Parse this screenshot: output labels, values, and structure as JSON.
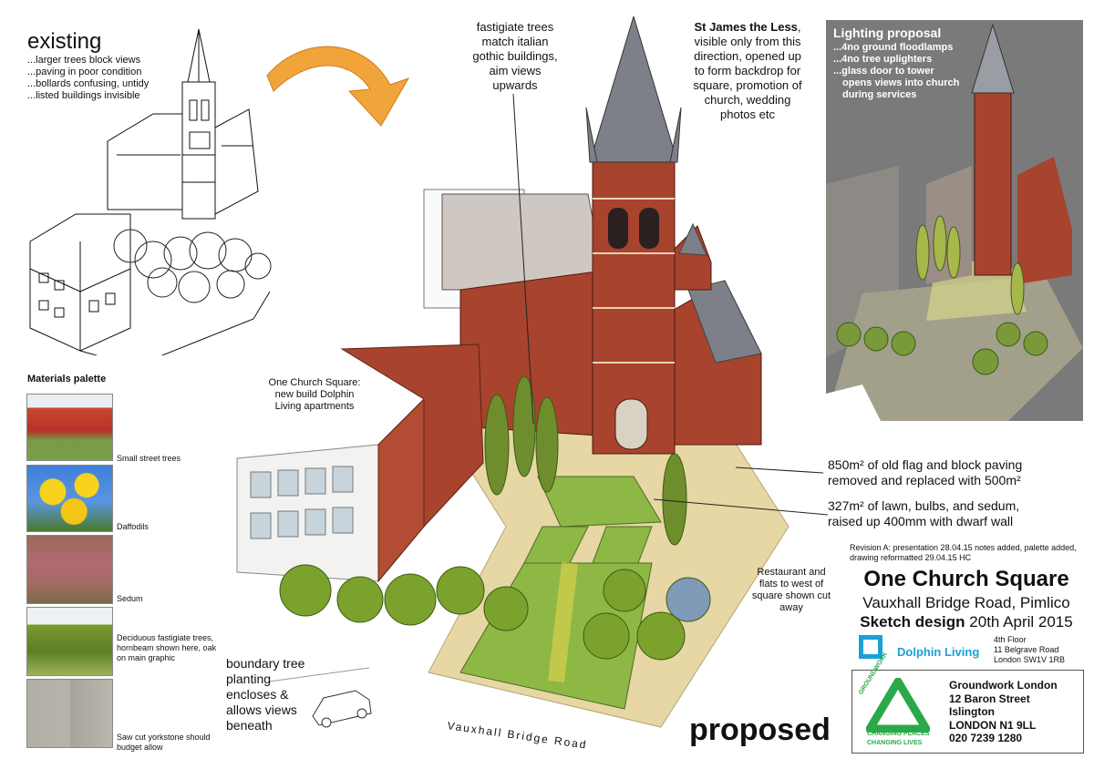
{
  "existing": {
    "heading": "existing",
    "notes": [
      "...larger trees block views",
      "...paving in poor condition",
      "...bollards confusing, untidy",
      "...listed buildings invisible"
    ]
  },
  "annotations": {
    "fastigiate": [
      "fastigiate trees",
      "match italian",
      "gothic buildings,",
      "aim views",
      "upwards"
    ],
    "church_bold": "St James the Less",
    "church_rest": [
      "visible only from this",
      "direction, opened up",
      "to form backdrop for",
      "square, promotion of",
      "church, wedding",
      "photos etc"
    ],
    "one_church": [
      "One Church Square:",
      "new build Dolphin",
      "Living apartments"
    ],
    "paving": [
      "850m² of old flag and block paving",
      "removed and replaced with 500m²"
    ],
    "lawn": [
      "327m² of lawn, bulbs, and sedum,",
      "raised up 400mm with dwarf wall"
    ],
    "restaurant": [
      "Restaurant and",
      "flats to west of",
      "square shown cut",
      "away"
    ],
    "boundary": [
      "boundary tree",
      "planting",
      "encloses &",
      "allows views",
      "beneath"
    ],
    "road": "Vauxhall Bridge Road",
    "proposed": "proposed"
  },
  "lighting": {
    "title": "Lighting proposal",
    "items": [
      "...4no ground floodlamps",
      "...4no tree uplighters",
      "...glass door to tower",
      "opens views into church",
      "during services"
    ]
  },
  "palette": {
    "title": "Materials palette",
    "items": [
      {
        "label": "Small street trees",
        "icon": "street-trees-photo"
      },
      {
        "label": "Daffodils",
        "icon": "daffodils-photo"
      },
      {
        "label": "Sedum",
        "icon": "sedum-photo"
      },
      {
        "label": "Deciduous fastigiate trees, hornbeam shown here, oak on main graphic",
        "icon": "fastigiate-trees-photo"
      },
      {
        "label": "Saw cut yorkstone should budget allow",
        "icon": "yorkstone-photo"
      }
    ]
  },
  "revision": [
    "Revision A: presentation 28.04.15 notes added, palette added,",
    "drawing reformatted 29.04.15 HC"
  ],
  "title_block": {
    "title": "One Church Square",
    "subtitle": "Vauxhall Bridge Road, Pimlico",
    "design_bold": "Sketch design",
    "design_date": "20th April 2015"
  },
  "dolphin": {
    "name": "Dolphin Living",
    "address": [
      "4th Floor",
      "11 Belgrave Road",
      "London SW1V 1RB"
    ],
    "color": "#1aa0d8"
  },
  "groundwork": {
    "logo_text": "GROUNDWORK",
    "tag1": "CHANGING PLACES",
    "tag2": "CHANGING LIVES",
    "address": [
      "Groundwork London",
      "12 Baron Street",
      "Islington",
      "LONDON N1 9LL",
      "020 7239 1280"
    ],
    "color": "#2aa84a"
  },
  "colors": {
    "brick": "#a8432e",
    "slate": "#7d8088",
    "lawn": "#8db846",
    "paving": "#e6d7a4",
    "arrow": "#f0a43a"
  }
}
